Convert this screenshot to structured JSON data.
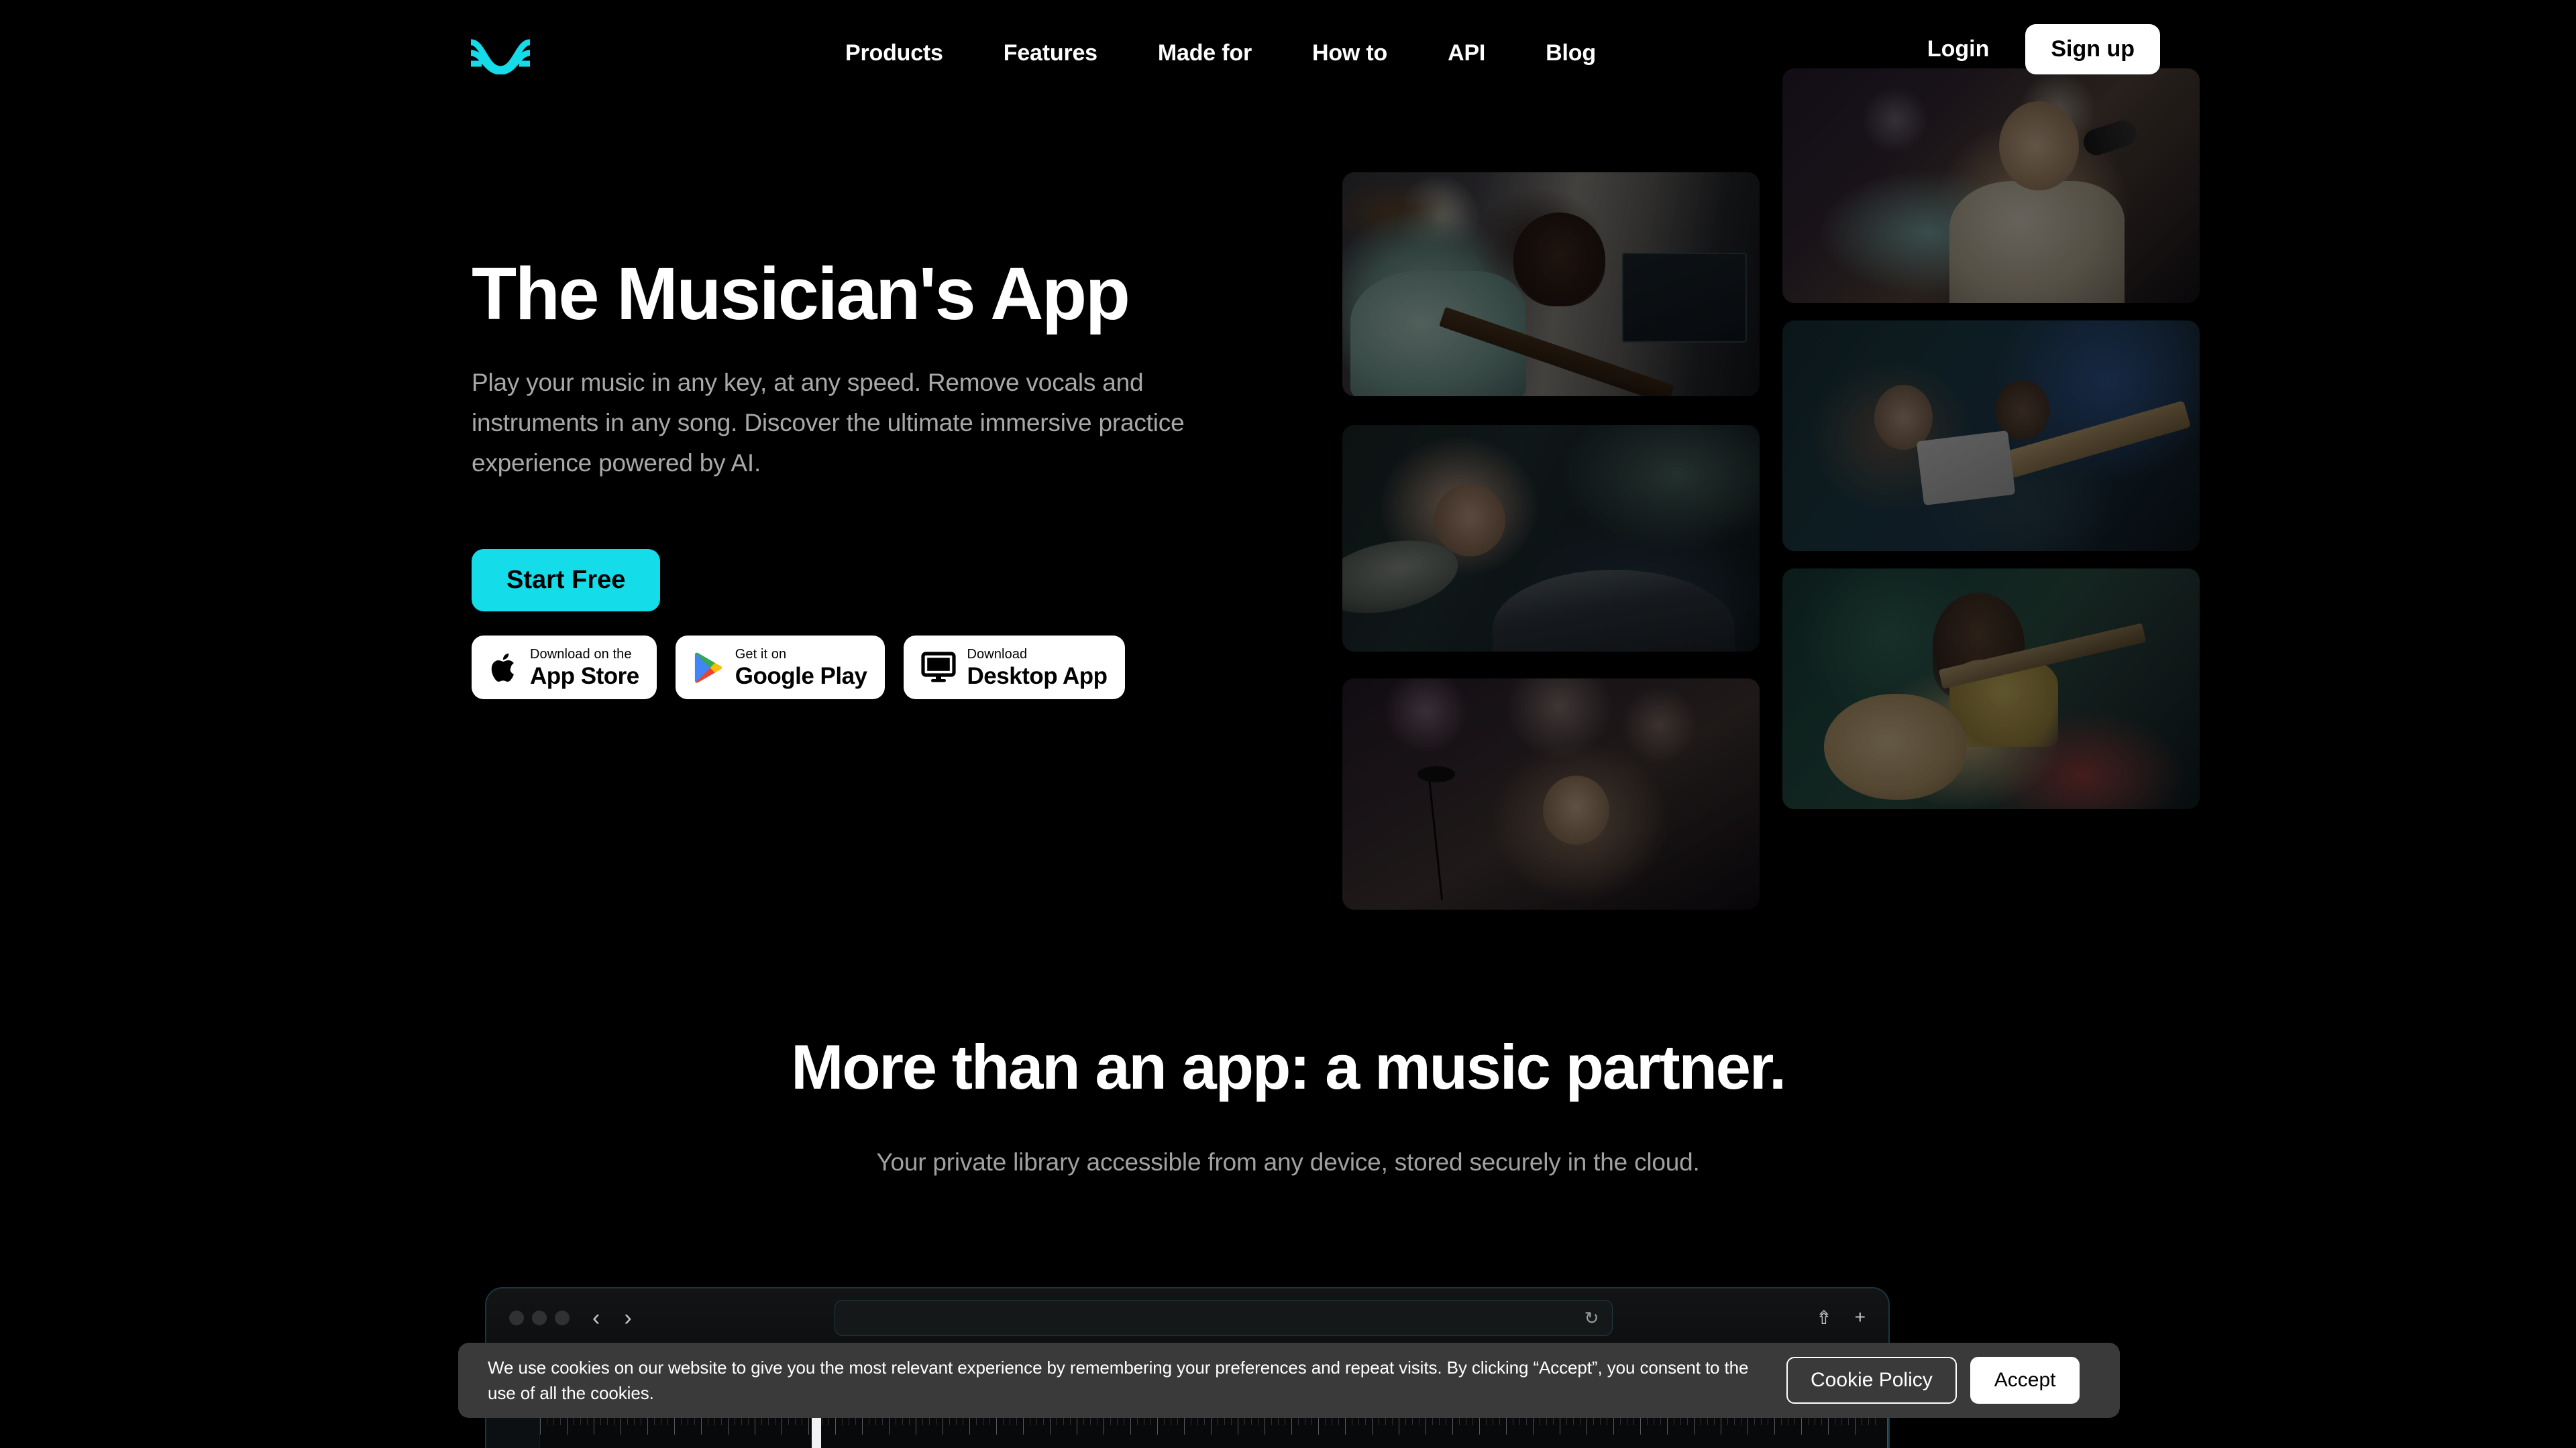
{
  "brand": {
    "logo_icon": "wave-logo-icon",
    "accent_color": "#14DCE9",
    "background_color": "#000000"
  },
  "nav": {
    "links": [
      {
        "label": "Products"
      },
      {
        "label": "Features"
      },
      {
        "label": "Made for"
      },
      {
        "label": "How to"
      },
      {
        "label": "API"
      },
      {
        "label": "Blog"
      }
    ],
    "login_label": "Login",
    "signup_label": "Sign up"
  },
  "hero": {
    "title": "The Musician's App",
    "subtitle": "Play your music in any key, at any speed. Remove vocals and instruments in any song. Discover the ultimate immersive practice experience powered by AI.",
    "cta_label": "Start Free",
    "badges": [
      {
        "icon": "apple-icon",
        "small": "Download on the",
        "big": "App Store"
      },
      {
        "icon": "google-play-icon",
        "small": "Get it on",
        "big": "Google Play"
      },
      {
        "icon": "desktop-monitor-icon",
        "small": "Download",
        "big": "Desktop App"
      }
    ],
    "gallery": [
      {
        "name": "bass-player-home-studio"
      },
      {
        "name": "drummer-smiling"
      },
      {
        "name": "bassist-at-microphone"
      },
      {
        "name": "singer-at-microphone"
      },
      {
        "name": "duo-with-tablet-and-guitar"
      },
      {
        "name": "woman-with-acoustic-guitar"
      }
    ]
  },
  "section2": {
    "title": "More than an app: a music partner.",
    "subtitle": "Your private library accessible from any device, stored securely in the cloud."
  },
  "browser_mockup": {
    "traffic_lights": 3,
    "back_icon": "chevron-left-icon",
    "forward_icon": "chevron-right-icon",
    "url_value": "",
    "url_placeholder": "",
    "reload_icon": "reload-icon",
    "share_icon": "share-icon",
    "new_tab_icon": "plus-icon"
  },
  "cookie_banner": {
    "text": "We use cookies on our website to give you the most relevant experience by remembering your preferences and repeat visits. By clicking “Accept”, you consent to the use of all the cookies.",
    "policy_label": "Cookie Policy",
    "accept_label": "Accept"
  }
}
